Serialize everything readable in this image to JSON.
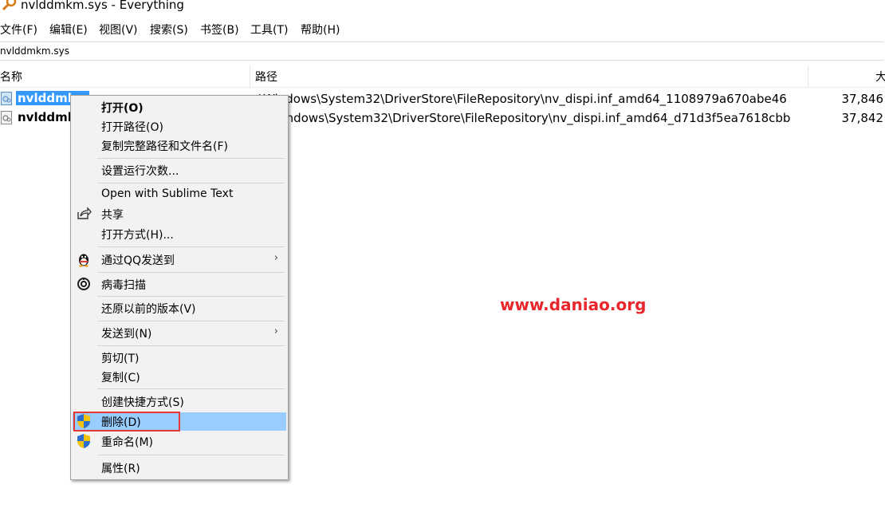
{
  "window": {
    "title": "nvlddmkm.sys - Everything"
  },
  "menubar": [
    {
      "label": "文件(F)"
    },
    {
      "label": "编辑(E)"
    },
    {
      "label": "视图(V)"
    },
    {
      "label": "搜索(S)"
    },
    {
      "label": "书签(B)"
    },
    {
      "label": "工具(T)"
    },
    {
      "label": "帮助(H)"
    }
  ],
  "search": {
    "value": "nvlddmkm.sys"
  },
  "columns": {
    "name": "名称",
    "path": "路径",
    "size": "大"
  },
  "results": [
    {
      "name": "nvlddmkm",
      "path": ":\\Windows\\System32\\DriverStore\\FileRepository\\nv_dispi.inf_amd64_1108979a670abe46",
      "size": "37,846",
      "selected": true
    },
    {
      "name": "nvlddmk",
      "path": "Windows\\System32\\DriverStore\\FileRepository\\nv_dispi.inf_amd64_d71d3f5ea7618cbb",
      "size": "37,842",
      "selected": false
    }
  ],
  "context_menu": {
    "items": [
      {
        "label": "打开(O)"
      },
      {
        "label": "打开路径(O)"
      },
      {
        "label": "复制完整路径和文件名(F)"
      },
      {
        "label": "设置运行次数..."
      },
      {
        "label": "Open with Sublime Text"
      },
      {
        "label": "共享"
      },
      {
        "label": "打开方式(H)..."
      },
      {
        "label": "通过QQ发送到"
      },
      {
        "label": "病毒扫描"
      },
      {
        "label": "还原以前的版本(V)"
      },
      {
        "label": "发送到(N)"
      },
      {
        "label": "剪切(T)"
      },
      {
        "label": "复制(C)"
      },
      {
        "label": "创建快捷方式(S)"
      },
      {
        "label": "删除(D)"
      },
      {
        "label": "重命名(M)"
      },
      {
        "label": "属性(R)"
      }
    ],
    "arrow": "›"
  },
  "watermark": "www.daniao.org",
  "colors": {
    "selection": "#3399ff",
    "menu_hover": "#99ccff",
    "watermark": "#e8272d",
    "highlight_box": "#e53935"
  }
}
